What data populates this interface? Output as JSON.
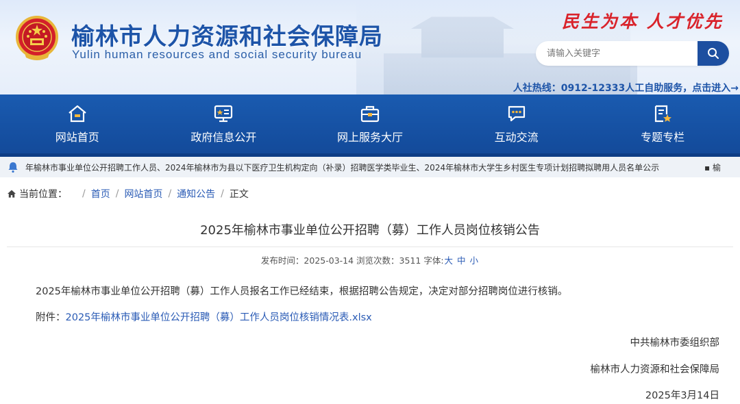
{
  "header": {
    "site_title": "榆林市人力资源和社会保障局",
    "site_subtitle": "Yulin human resources and social security bureau",
    "slogan": "民生为本  人才优先",
    "search_placeholder": "请输入关键字",
    "hotline": "人社热线：0912-12333人工自助服务，点击进入→"
  },
  "nav": {
    "items": [
      {
        "label": "网站首页",
        "icon": "home-icon"
      },
      {
        "label": "政府信息公开",
        "icon": "info-board-icon"
      },
      {
        "label": "网上服务大厅",
        "icon": "briefcase-icon"
      },
      {
        "label": "互动交流",
        "icon": "chat-icon"
      },
      {
        "label": "专题专栏",
        "icon": "special-column-icon"
      }
    ]
  },
  "ticker": {
    "text": "年榆林市事业单位公开招聘工作人员、2024年榆林市为县以下医疗卫生机构定向（补录）招聘医学类毕业生、2024年榆林市大学生乡村医生专项计划招聘拟聘用人员名单公示",
    "next": "▪ 榆"
  },
  "breadcrumb": {
    "label": "当前位置：",
    "items": [
      "首页",
      "网站首页",
      "通知公告"
    ],
    "current": "正文"
  },
  "article": {
    "title": "2025年榆林市事业单位公开招聘（募）工作人员岗位核销公告",
    "meta_prefix": "发布时间：2025-03-14 浏览次数：3511 字体:",
    "font_sizes": [
      "大",
      "中",
      "小"
    ],
    "body": "2025年榆林市事业单位公开招聘（募）工作人员报名工作已经结束，根据招聘公告规定，决定对部分招聘岗位进行核销。",
    "attachment_label": "附件：",
    "attachment_link": "2025年榆林市事业单位公开招聘（募）工作人员岗位核销情况表.xlsx",
    "signatures": [
      "中共榆林市委组织部",
      "榆林市人力资源和社会保障局"
    ],
    "date": "2025年3月14日"
  },
  "colors": {
    "brand_blue": "#1a5bb0",
    "link_blue": "#2a5bb5",
    "slogan_red": "#d9232b"
  }
}
